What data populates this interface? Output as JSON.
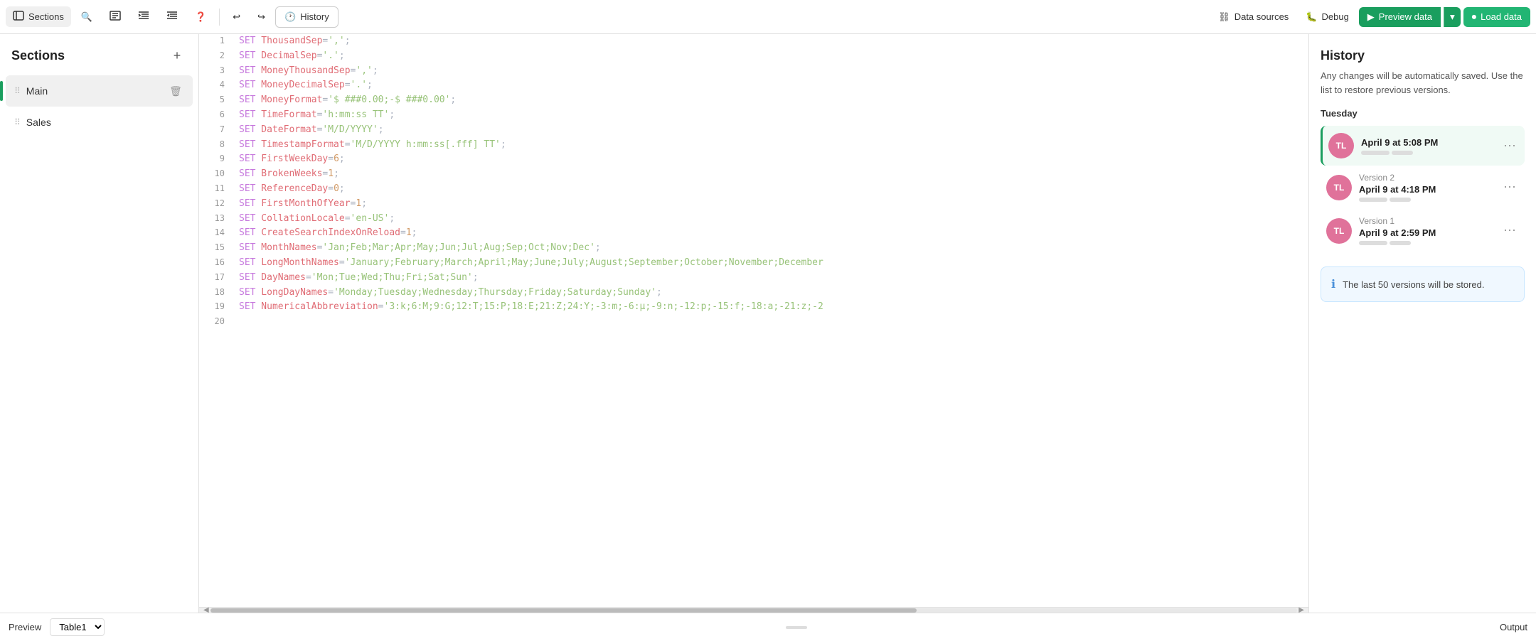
{
  "toolbar": {
    "sections_label": "Sections",
    "history_label": "History",
    "data_sources_label": "Data sources",
    "debug_label": "Debug",
    "preview_data_label": "Preview data",
    "load_data_label": "Load data"
  },
  "sidebar": {
    "title": "Sections",
    "add_icon": "+",
    "items": [
      {
        "id": "main",
        "label": "Main",
        "active": true
      },
      {
        "id": "sales",
        "label": "Sales",
        "active": false
      }
    ]
  },
  "editor": {
    "lines": [
      {
        "num": 1,
        "code": "SET ThousandSep=',';",
        "tokens": [
          {
            "t": "kw",
            "v": "SET"
          },
          {
            "t": "prop",
            "v": " ThousandSep"
          },
          {
            "t": "punct",
            "v": "="
          },
          {
            "t": "val",
            "v": "','"
          },
          {
            "t": "punct",
            "v": ";"
          }
        ]
      },
      {
        "num": 2,
        "code": "SET DecimalSep='.';",
        "tokens": [
          {
            "t": "kw",
            "v": "SET"
          },
          {
            "t": "prop",
            "v": " DecimalSep"
          },
          {
            "t": "punct",
            "v": "="
          },
          {
            "t": "val",
            "v": "'.'"
          },
          {
            "t": "punct",
            "v": ";"
          }
        ]
      },
      {
        "num": 3,
        "code": "SET MoneyThousandSep=',';",
        "tokens": [
          {
            "t": "kw",
            "v": "SET"
          },
          {
            "t": "prop",
            "v": " MoneyThousandSep"
          },
          {
            "t": "punct",
            "v": "="
          },
          {
            "t": "val",
            "v": "','"
          },
          {
            "t": "punct",
            "v": ";"
          }
        ]
      },
      {
        "num": 4,
        "code": "SET MoneyDecimalSep='.';",
        "tokens": [
          {
            "t": "kw",
            "v": "SET"
          },
          {
            "t": "prop",
            "v": " MoneyDecimalSep"
          },
          {
            "t": "punct",
            "v": "="
          },
          {
            "t": "val",
            "v": "'.'"
          },
          {
            "t": "punct",
            "v": ";"
          }
        ]
      },
      {
        "num": 5,
        "code": "SET MoneyFormat='$ ###0.00;-$ ###0.00';",
        "tokens": [
          {
            "t": "kw",
            "v": "SET"
          },
          {
            "t": "prop",
            "v": " MoneyFormat"
          },
          {
            "t": "punct",
            "v": "="
          },
          {
            "t": "val",
            "v": "'$ ###0.00;-$ ###0.00'"
          },
          {
            "t": "punct",
            "v": ";"
          }
        ]
      },
      {
        "num": 6,
        "code": "SET TimeFormat='h:mm:ss TT';",
        "tokens": [
          {
            "t": "kw",
            "v": "SET"
          },
          {
            "t": "prop",
            "v": " TimeFormat"
          },
          {
            "t": "punct",
            "v": "="
          },
          {
            "t": "val",
            "v": "'h:mm:ss TT'"
          },
          {
            "t": "punct",
            "v": ";"
          }
        ]
      },
      {
        "num": 7,
        "code": "SET DateFormat='M/D/YYYY';",
        "tokens": [
          {
            "t": "kw",
            "v": "SET"
          },
          {
            "t": "prop",
            "v": " DateFormat"
          },
          {
            "t": "punct",
            "v": "="
          },
          {
            "t": "val",
            "v": "'M/D/YYYY'"
          },
          {
            "t": "punct",
            "v": ";"
          }
        ]
      },
      {
        "num": 8,
        "code": "SET TimestampFormat='M/D/YYYY h:mm:ss[.fff] TT';",
        "tokens": [
          {
            "t": "kw",
            "v": "SET"
          },
          {
            "t": "prop",
            "v": " TimestampFormat"
          },
          {
            "t": "punct",
            "v": "="
          },
          {
            "t": "val",
            "v": "'M/D/YYYY h:mm:ss[.fff] TT'"
          },
          {
            "t": "punct",
            "v": ";"
          }
        ]
      },
      {
        "num": 9,
        "code": "SET FirstWeekDay=6;",
        "tokens": [
          {
            "t": "kw",
            "v": "SET"
          },
          {
            "t": "prop",
            "v": " FirstWeekDay"
          },
          {
            "t": "punct",
            "v": "="
          },
          {
            "t": "num",
            "v": "6"
          },
          {
            "t": "punct",
            "v": ";"
          }
        ]
      },
      {
        "num": 10,
        "code": "SET BrokenWeeks=1;",
        "tokens": [
          {
            "t": "kw",
            "v": "SET"
          },
          {
            "t": "prop",
            "v": " BrokenWeeks"
          },
          {
            "t": "punct",
            "v": "="
          },
          {
            "t": "num",
            "v": "1"
          },
          {
            "t": "punct",
            "v": ";"
          }
        ]
      },
      {
        "num": 11,
        "code": "SET ReferenceDay=0;",
        "tokens": [
          {
            "t": "kw",
            "v": "SET"
          },
          {
            "t": "prop",
            "v": " ReferenceDay"
          },
          {
            "t": "punct",
            "v": "="
          },
          {
            "t": "num",
            "v": "0"
          },
          {
            "t": "punct",
            "v": ";"
          }
        ]
      },
      {
        "num": 12,
        "code": "SET FirstMonthOfYear=1;",
        "tokens": [
          {
            "t": "kw",
            "v": "SET"
          },
          {
            "t": "prop",
            "v": " FirstMonthOfYear"
          },
          {
            "t": "punct",
            "v": "="
          },
          {
            "t": "num",
            "v": "1"
          },
          {
            "t": "punct",
            "v": ";"
          }
        ]
      },
      {
        "num": 13,
        "code": "SET CollationLocale='en-US';",
        "tokens": [
          {
            "t": "kw",
            "v": "SET"
          },
          {
            "t": "prop",
            "v": " CollationLocale"
          },
          {
            "t": "punct",
            "v": "="
          },
          {
            "t": "val",
            "v": "'en-US'"
          },
          {
            "t": "punct",
            "v": ";"
          }
        ]
      },
      {
        "num": 14,
        "code": "SET CreateSearchIndexOnReload=1;",
        "tokens": [
          {
            "t": "kw",
            "v": "SET"
          },
          {
            "t": "prop",
            "v": " CreateSearchIndexOnReload"
          },
          {
            "t": "punct",
            "v": "="
          },
          {
            "t": "num",
            "v": "1"
          },
          {
            "t": "punct",
            "v": ";"
          }
        ]
      },
      {
        "num": 15,
        "code": "SET MonthNames='Jan;Feb;Mar;Apr;May;Jun;Jul;Aug;Sep;Oct;Nov;Dec';",
        "tokens": [
          {
            "t": "kw",
            "v": "SET"
          },
          {
            "t": "prop",
            "v": " MonthNames"
          },
          {
            "t": "punct",
            "v": "="
          },
          {
            "t": "val",
            "v": "'Jan;Feb;Mar;Apr;May;Jun;Jul;Aug;Sep;Oct;Nov;Dec'"
          },
          {
            "t": "punct",
            "v": ";"
          }
        ]
      },
      {
        "num": 16,
        "code": "SET LongMonthNames='January;February;March;April;May;June;July;August;September;October;November;December",
        "tokens": [
          {
            "t": "kw",
            "v": "SET"
          },
          {
            "t": "prop",
            "v": " LongMonthNames"
          },
          {
            "t": "punct",
            "v": "="
          },
          {
            "t": "val",
            "v": "'January;February;March;April;May;June;July;August;September;October;November;December"
          }
        ]
      },
      {
        "num": 17,
        "code": "SET DayNames='Mon;Tue;Wed;Thu;Fri;Sat;Sun';",
        "tokens": [
          {
            "t": "kw",
            "v": "SET"
          },
          {
            "t": "prop",
            "v": " DayNames"
          },
          {
            "t": "punct",
            "v": "="
          },
          {
            "t": "val",
            "v": "'Mon;Tue;Wed;Thu;Fri;Sat;Sun'"
          },
          {
            "t": "punct",
            "v": ";"
          }
        ]
      },
      {
        "num": 18,
        "code": "SET LongDayNames='Monday;Tuesday;Wednesday;Thursday;Friday;Saturday;Sunday';",
        "tokens": [
          {
            "t": "kw",
            "v": "SET"
          },
          {
            "t": "prop",
            "v": " LongDayNames"
          },
          {
            "t": "punct",
            "v": "="
          },
          {
            "t": "val",
            "v": "'Monday;Tuesday;Wednesday;Thursday;Friday;Saturday;Sunday'"
          },
          {
            "t": "punct",
            "v": ";"
          }
        ]
      },
      {
        "num": 19,
        "code": "SET NumericalAbbreviation='3:k;6:M;9:G;12:T;15:P;18:E;21:Z;24:Y;-3:m;-6:μ;-9:n;-12:p;-15:f;-18:a;-21:z;-2",
        "tokens": [
          {
            "t": "kw",
            "v": "SET"
          },
          {
            "t": "prop",
            "v": " NumericalAbbreviation"
          },
          {
            "t": "punct",
            "v": "="
          },
          {
            "t": "val",
            "v": "'3:k;6:M;9:G;12:T;15:P;18:E;21:Z;24:Y;-3:m;-6:μ;-9:n;-12:p;-15:f;-18:a;-21:z;-2"
          }
        ]
      },
      {
        "num": 20,
        "code": "",
        "tokens": []
      }
    ]
  },
  "history": {
    "title": "History",
    "description": "Any changes will be automatically saved. Use the list to restore previous versions.",
    "day_label": "Tuesday",
    "entries": [
      {
        "id": "current",
        "avatar_initials": "TL",
        "time": "April 9 at 5:08 PM",
        "version_label": "",
        "active": true
      },
      {
        "id": "v2",
        "avatar_initials": "TL",
        "time": "April 9 at 4:18 PM",
        "version_label": "Version 2",
        "active": false
      },
      {
        "id": "v1",
        "avatar_initials": "TL",
        "time": "April 9 at 2:59 PM",
        "version_label": "Version 1",
        "active": false
      }
    ],
    "info_text": "The last 50 versions will be stored."
  },
  "bottom": {
    "preview_label": "Preview",
    "table_select_value": "Table1",
    "output_label": "Output"
  }
}
